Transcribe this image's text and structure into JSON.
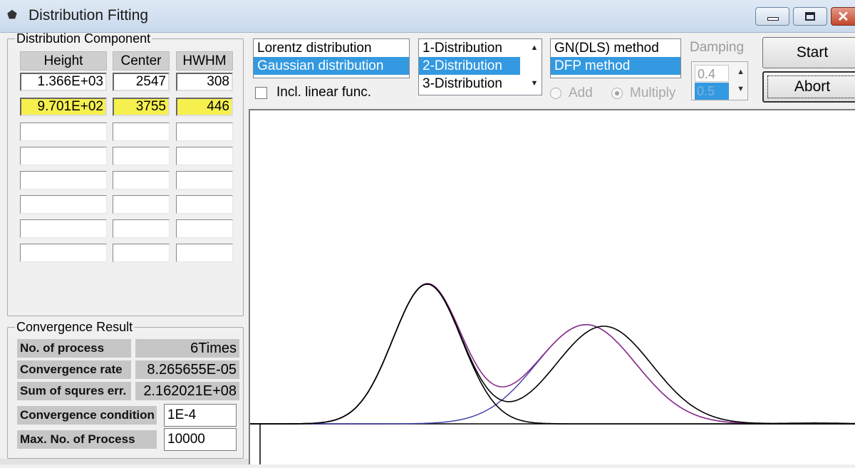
{
  "window": {
    "title": "Distribution Fitting"
  },
  "component_group": {
    "title": "Distribution Component",
    "headers": [
      "Height",
      "Center",
      "HWHM"
    ],
    "rows": [
      {
        "height": "1.366E+03",
        "center": "2547",
        "hwhm": "308",
        "highlighted": false
      },
      {
        "height": "9.701E+02",
        "center": "3755",
        "hwhm": "446",
        "highlighted": true
      }
    ],
    "highlight_color": "#f6f04f"
  },
  "distribution_list": {
    "items": [
      "Lorentz distribution",
      "Gaussian distribution"
    ],
    "selected": "Gaussian distribution"
  },
  "count_list": {
    "items": [
      "1-Distribution",
      "2-Distribution",
      "3-Distribution"
    ],
    "selected": "2-Distribution"
  },
  "method_list": {
    "items": [
      "GN(DLS) method",
      "DFP method"
    ],
    "selected": "DFP method"
  },
  "linear_func": {
    "label": "Incl. linear func.",
    "checked": false
  },
  "combine": {
    "add_label": "Add",
    "multiply_label": "Multiply",
    "selected": "Multiply"
  },
  "damping": {
    "label": "Damping",
    "options": [
      "0.4",
      "0.5"
    ],
    "selected": "0.5"
  },
  "buttons": {
    "start": "Start",
    "abort": "Abort"
  },
  "convergence": {
    "title": "Convergence Result",
    "rows": [
      {
        "label": "No. of process",
        "value": "6Times"
      },
      {
        "label": "Convergence rate",
        "value": "8.265655E-05"
      },
      {
        "label": "Sum of squres err.",
        "value": "2.162021E+08"
      }
    ],
    "condition_label": "Convergence condition",
    "condition_value": "1E-4",
    "max_label": "Max. No. of Process",
    "max_value": "10000"
  },
  "colors": {
    "selection": "#3399e0",
    "fit_curve": "#8b2e8b",
    "component_2": "#3a3aa8",
    "measured_curve": "#000000"
  },
  "chart_data": {
    "type": "line",
    "xlim": [
      1200,
      5800
    ],
    "series": [
      {
        "type": "gaussian",
        "height": 1366,
        "center": 2547,
        "hwhm": 308,
        "color": "#000000"
      },
      {
        "type": "gaussian",
        "height": 970.1,
        "center": 3755,
        "hwhm": 446,
        "color": "#3a3aa8"
      },
      {
        "type": "sum",
        "color": "#8b2e8b"
      },
      {
        "type": "measured",
        "color": "#000000"
      }
    ]
  }
}
